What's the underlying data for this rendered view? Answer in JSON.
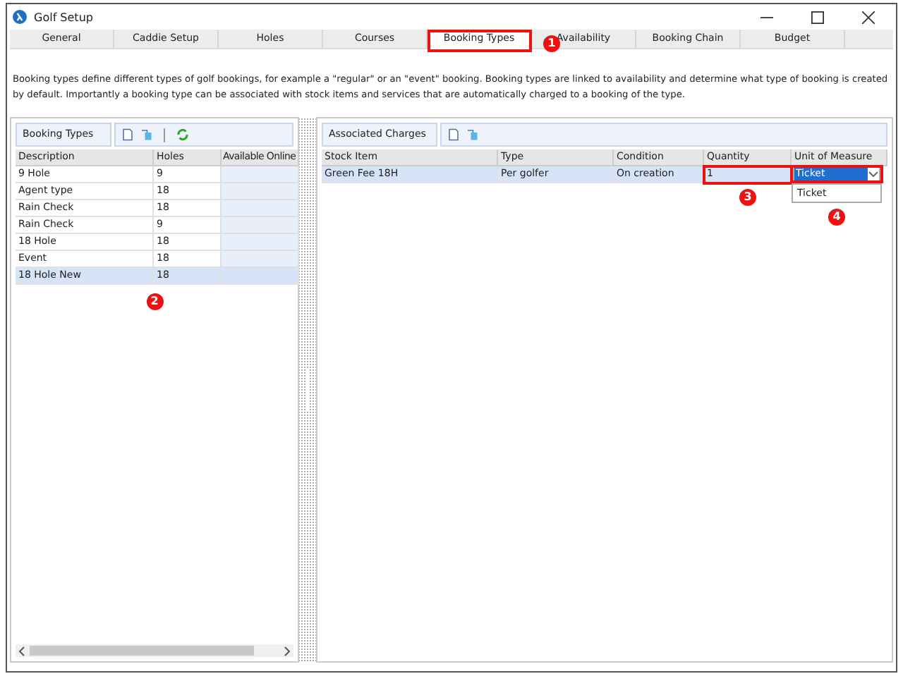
{
  "window": {
    "title": "Golf Setup"
  },
  "tabs": [
    {
      "label": "General",
      "selected": false
    },
    {
      "label": "Caddie Setup",
      "selected": false
    },
    {
      "label": "Holes",
      "selected": false
    },
    {
      "label": "Courses",
      "selected": false
    },
    {
      "label": "Booking Types",
      "selected": true
    },
    {
      "label": "Availability",
      "selected": false
    },
    {
      "label": "Booking Chain",
      "selected": false
    },
    {
      "label": "Budget",
      "selected": false
    }
  ],
  "description": "Booking types define different types of golf bookings, for example a \"regular\" or an \"event\" booking. Booking types are linked to availability and determine what type of booking is created by default. Importantly a booking type can be associated with stock items and services that are automatically charged to a booking of the type.",
  "booking_types": {
    "title": "Booking Types",
    "columns": [
      "Description",
      "Holes",
      "Available Online"
    ],
    "rows": [
      {
        "cells": [
          "9 Hole",
          "9"
        ],
        "selected": false
      },
      {
        "cells": [
          "Agent type",
          "18"
        ],
        "selected": false
      },
      {
        "cells": [
          "Rain Check",
          "18"
        ],
        "selected": false
      },
      {
        "cells": [
          "Rain Check",
          "9"
        ],
        "selected": false
      },
      {
        "cells": [
          "18 Hole",
          "18"
        ],
        "selected": false
      },
      {
        "cells": [
          "Event",
          "18"
        ],
        "selected": false
      },
      {
        "cells": [
          "18 Hole New",
          "18"
        ],
        "selected": true
      }
    ]
  },
  "charges": {
    "title": "Associated Charges",
    "columns": [
      "Stock Item",
      "Type",
      "Condition",
      "Quantity",
      "Unit of Measure"
    ],
    "rows": [
      {
        "cells": [
          "Green Fee 18H",
          "Per golfer",
          "On creation",
          "1",
          "Ticket"
        ],
        "selected": true
      }
    ],
    "dropdown_options": [
      "Ticket"
    ]
  },
  "callouts": [
    "1",
    "2",
    "3",
    "4"
  ]
}
